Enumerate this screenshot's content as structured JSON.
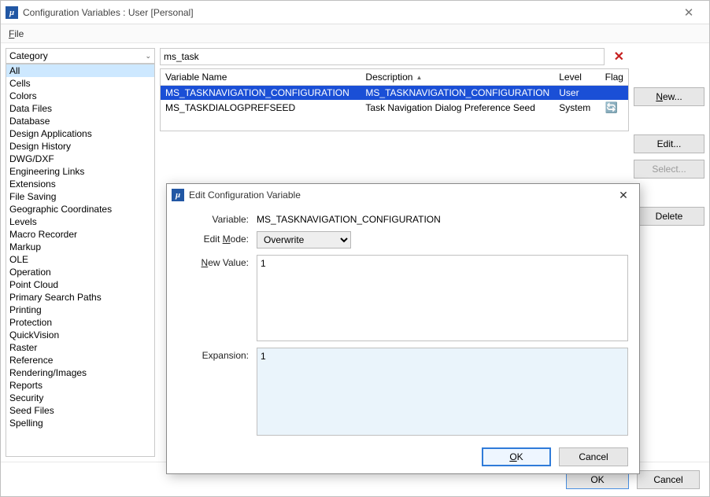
{
  "window": {
    "title": "Configuration Variables : User [Personal]",
    "menu_file": "File"
  },
  "category": {
    "header": "Category",
    "items": [
      "All",
      "Cells",
      "Colors",
      "Data Files",
      "Database",
      "Design Applications",
      "Design History",
      "DWG/DXF",
      "Engineering Links",
      "Extensions",
      "File Saving",
      "Geographic Coordinates",
      "Levels",
      "Macro Recorder",
      "Markup",
      "OLE",
      "Operation",
      "Point Cloud",
      "Primary Search Paths",
      "Printing",
      "Protection",
      "QuickVision",
      "Raster",
      "Reference",
      "Rendering/Images",
      "Reports",
      "Security",
      "Seed Files",
      "Spelling"
    ],
    "selected_index": 0
  },
  "search": {
    "value": "ms_task"
  },
  "table": {
    "columns": {
      "name": "Variable Name",
      "desc": "Description",
      "level": "Level",
      "flag": "Flag"
    },
    "rows": [
      {
        "name": "MS_TASKNAVIGATION_CONFIGURATION",
        "desc": "MS_TASKNAVIGATION_CONFIGURATION",
        "level": "User",
        "flag": ""
      },
      {
        "name": "MS_TASKDIALOGPREFSEED",
        "desc": "Task Navigation Dialog Preference Seed",
        "level": "System",
        "flag": "refresh"
      }
    ],
    "selected_row": 0
  },
  "buttons": {
    "new": "New...",
    "edit": "Edit...",
    "select": "Select...",
    "delete": "Delete",
    "ok": "OK",
    "cancel": "Cancel"
  },
  "edit_dialog": {
    "title": "Edit Configuration Variable",
    "variable_label": "Variable:",
    "variable_value": "MS_TASKNAVIGATION_CONFIGURATION",
    "editmode_label": "Edit Mode:",
    "editmode_value": "Overwrite",
    "newvalue_label": "New Value:",
    "newvalue_value": "1",
    "expansion_label": "Expansion:",
    "expansion_value": "1",
    "ok": "OK",
    "cancel": "Cancel"
  }
}
